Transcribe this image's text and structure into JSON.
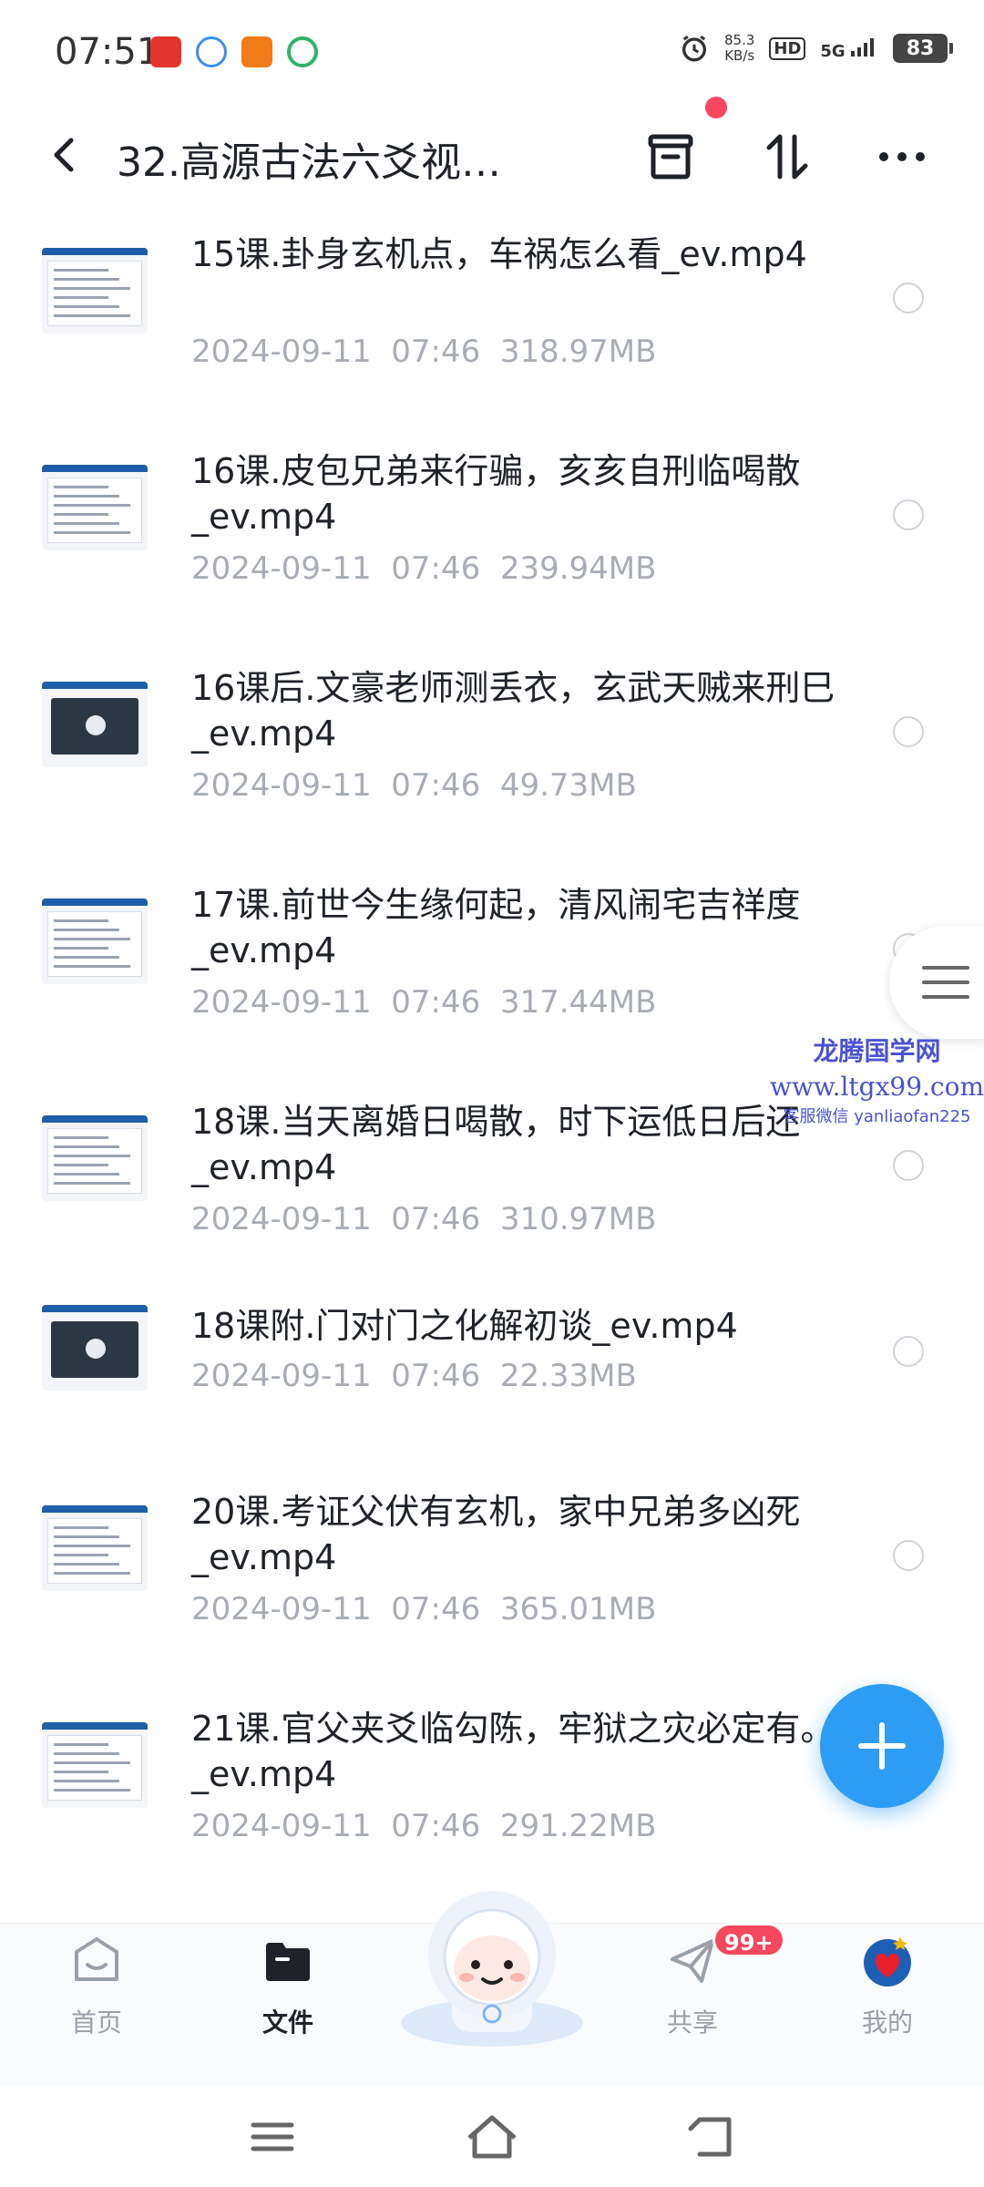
{
  "status_bar": {
    "time": "07:51",
    "net_speed_value": "85.3",
    "net_speed_unit": "KB/s",
    "hd": "HD",
    "signal": "5G",
    "battery": "83"
  },
  "header": {
    "title": "32.高源古法六爻视…"
  },
  "files": [
    {
      "name": "15课.卦身玄机点，车祸怎么看_ev.mp4",
      "date": "2024-09-11",
      "time": "07:46",
      "size": "318.97MB",
      "thumb": "doc"
    },
    {
      "name": "16课.皮包兄弟来行骗，亥亥自刑临喝散_ev.mp4",
      "date": "2024-09-11",
      "time": "07:46",
      "size": "239.94MB",
      "thumb": "doc"
    },
    {
      "name": "16课后.文豪老师测丢衣，玄武天贼来刑巳_ev.mp4",
      "date": "2024-09-11",
      "time": "07:46",
      "size": "49.73MB",
      "thumb": "dark"
    },
    {
      "name": "17课.前世今生缘何起，清风闹宅吉祥度_ev.mp4",
      "date": "2024-09-11",
      "time": "07:46",
      "size": "317.44MB",
      "thumb": "doc"
    },
    {
      "name": "18课.当天离婚日喝散，时下运低日后还_ev.mp4",
      "date": "2024-09-11",
      "time": "07:46",
      "size": "310.97MB",
      "thumb": "doc"
    },
    {
      "name": "18课附.门对门之化解初谈_ev.mp4",
      "date": "2024-09-11",
      "time": "07:46",
      "size": "22.33MB",
      "thumb": "dark"
    },
    {
      "name": "20课.考证父伏有玄机，家中兄弟多凶死_ev.mp4",
      "date": "2024-09-11",
      "time": "07:46",
      "size": "365.01MB",
      "thumb": "doc"
    },
    {
      "name": "21课.官父夹爻临勾陈，牢狱之灾必定有。_ev.mp4",
      "date": "2024-09-11",
      "time": "07:46",
      "size": "291.22MB",
      "thumb": "doc"
    }
  ],
  "watermark": {
    "line1": "龙腾国学网",
    "line2": "www.ltgx99.com",
    "line3": "客服微信 yanliaofan225"
  },
  "bottom_nav": {
    "home": "首页",
    "files": "文件",
    "share": "共享",
    "share_badge": "99+",
    "mine": "我的"
  },
  "colors": {
    "accent": "#2d9cf5",
    "badge": "#f5475e",
    "meta_text": "#a8adb5"
  }
}
